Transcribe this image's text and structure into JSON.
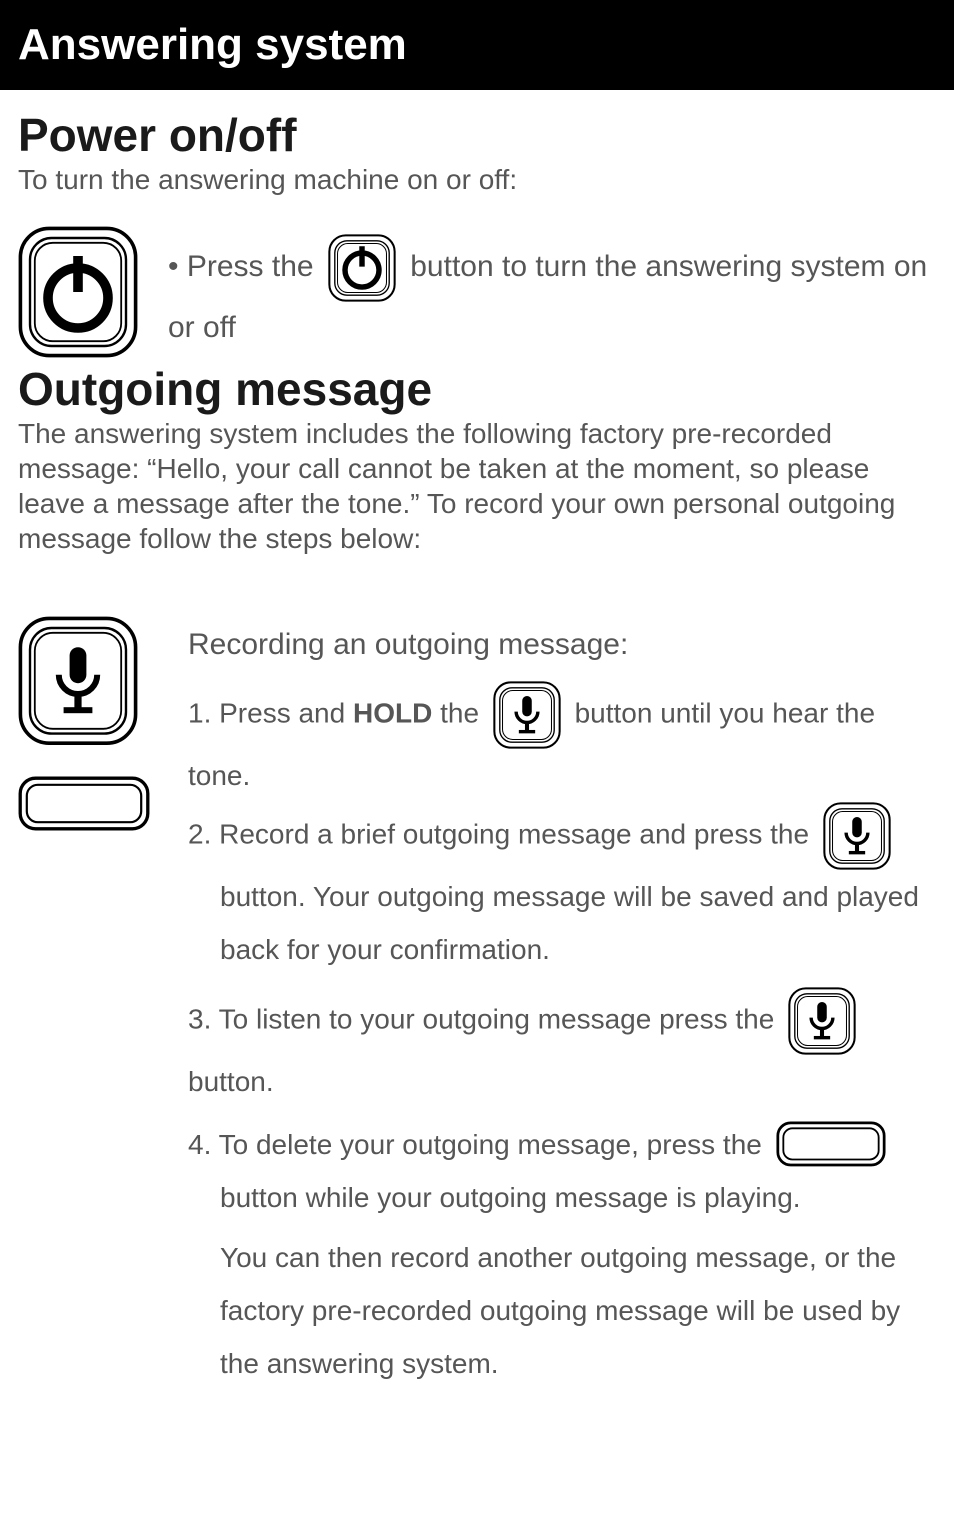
{
  "header": {
    "title": "Answering system"
  },
  "power": {
    "title": "Power on/off",
    "intro": "To turn the answering machine on or off:",
    "t1": "• Press the ",
    "t2": " button to turn the answering system on or off"
  },
  "outgoing": {
    "title": "Outgoing message",
    "intro": "The answering system includes the following factory pre-recorded message: “Hello, your call cannot be taken at the moment, so please leave a message after the tone.”  To record your own personal outgoing message follow the steps below:",
    "subtitle": "Recording an outgoing message:",
    "s1a": "1. Press and ",
    "s1hold": "HOLD",
    "s1b": " the ",
    "s1c": " button until you hear the tone.",
    "s2a": "2. Record a brief outgoing message and press the ",
    "s2b": " button.  Your outgoing message will be saved and played back for your confirmation.",
    "s3a": "3. To listen to your outgoing message press the ",
    "s3b": " button.",
    "s4a": "4. To delete your outgoing message, press the ",
    "s4b": " button while your outgoing message is playing.",
    "s4c": "You can then record another outgoing message, or the factory pre-recorded outgoing message will be used by the answering system."
  }
}
